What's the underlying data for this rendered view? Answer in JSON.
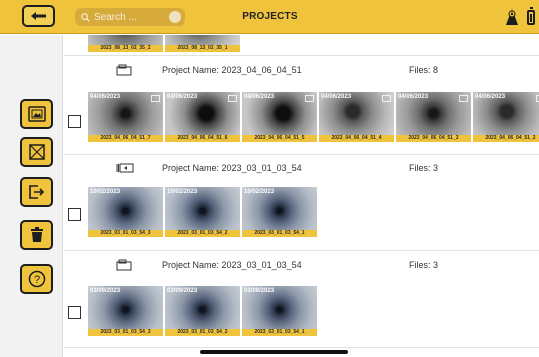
{
  "header": {
    "title": "PROJECTS",
    "search_placeholder": "Search ...",
    "back_icon": "back-arrow-icon",
    "camera_icon": "camera-icon",
    "battery_icon": "battery-icon",
    "accent_color": "#f0c33c"
  },
  "sidebar": {
    "buttons": [
      {
        "name": "import-photo-button",
        "icon": "photo-import-icon"
      },
      {
        "name": "select-all-button",
        "icon": "select-square-icon"
      },
      {
        "name": "export-button",
        "icon": "export-icon"
      },
      {
        "name": "delete-button",
        "icon": "trash-icon"
      },
      {
        "name": "help-button",
        "icon": "help-icon",
        "glyph": "?"
      }
    ]
  },
  "top_partial": {
    "captions": [
      "2023_08_13_02_35_2",
      "2023_08_13_02_35_1"
    ]
  },
  "projects": [
    {
      "name_label": "Project Name: 2023_04_06_04_51",
      "files_label": "Files: 8",
      "thumbnails": [
        {
          "date": "04/06/2023",
          "caption": "2023_04_06_04_51_7"
        },
        {
          "date": "04/06/2023",
          "caption": "2023_04_06_04_51_6"
        },
        {
          "date": "04/06/2023",
          "caption": "2023_04_06_04_51_5"
        },
        {
          "date": "04/06/2023",
          "caption": "2023_04_06_04_51_4"
        },
        {
          "date": "04/06/2023",
          "caption": "2023_04_06_04_51_3"
        },
        {
          "date": "04/06/2023",
          "caption": "2023_04_06_04_51_2"
        }
      ]
    },
    {
      "name_label": "Project Name: 2023_03_01_03_54",
      "files_label": "Files: 3",
      "thumbnails": [
        {
          "date": "10/02/2023",
          "caption": "2023_03_01_03_54_3"
        },
        {
          "date": "10/02/2023",
          "caption": "2023_03_01_03_54_2"
        },
        {
          "date": "10/02/2023",
          "caption": "2023_03_01_03_54_1"
        }
      ]
    },
    {
      "name_label": "Project Name: 2023_03_01_03_54",
      "files_label": "Files: 3",
      "thumbnails": [
        {
          "date": "03/09/2023",
          "caption": "2023_03_01_03_54_3"
        },
        {
          "date": "03/09/2023",
          "caption": "2023_03_01_03_54_2"
        },
        {
          "date": "03/09/2023",
          "caption": "2023_03_01_03_54_1"
        }
      ]
    }
  ]
}
